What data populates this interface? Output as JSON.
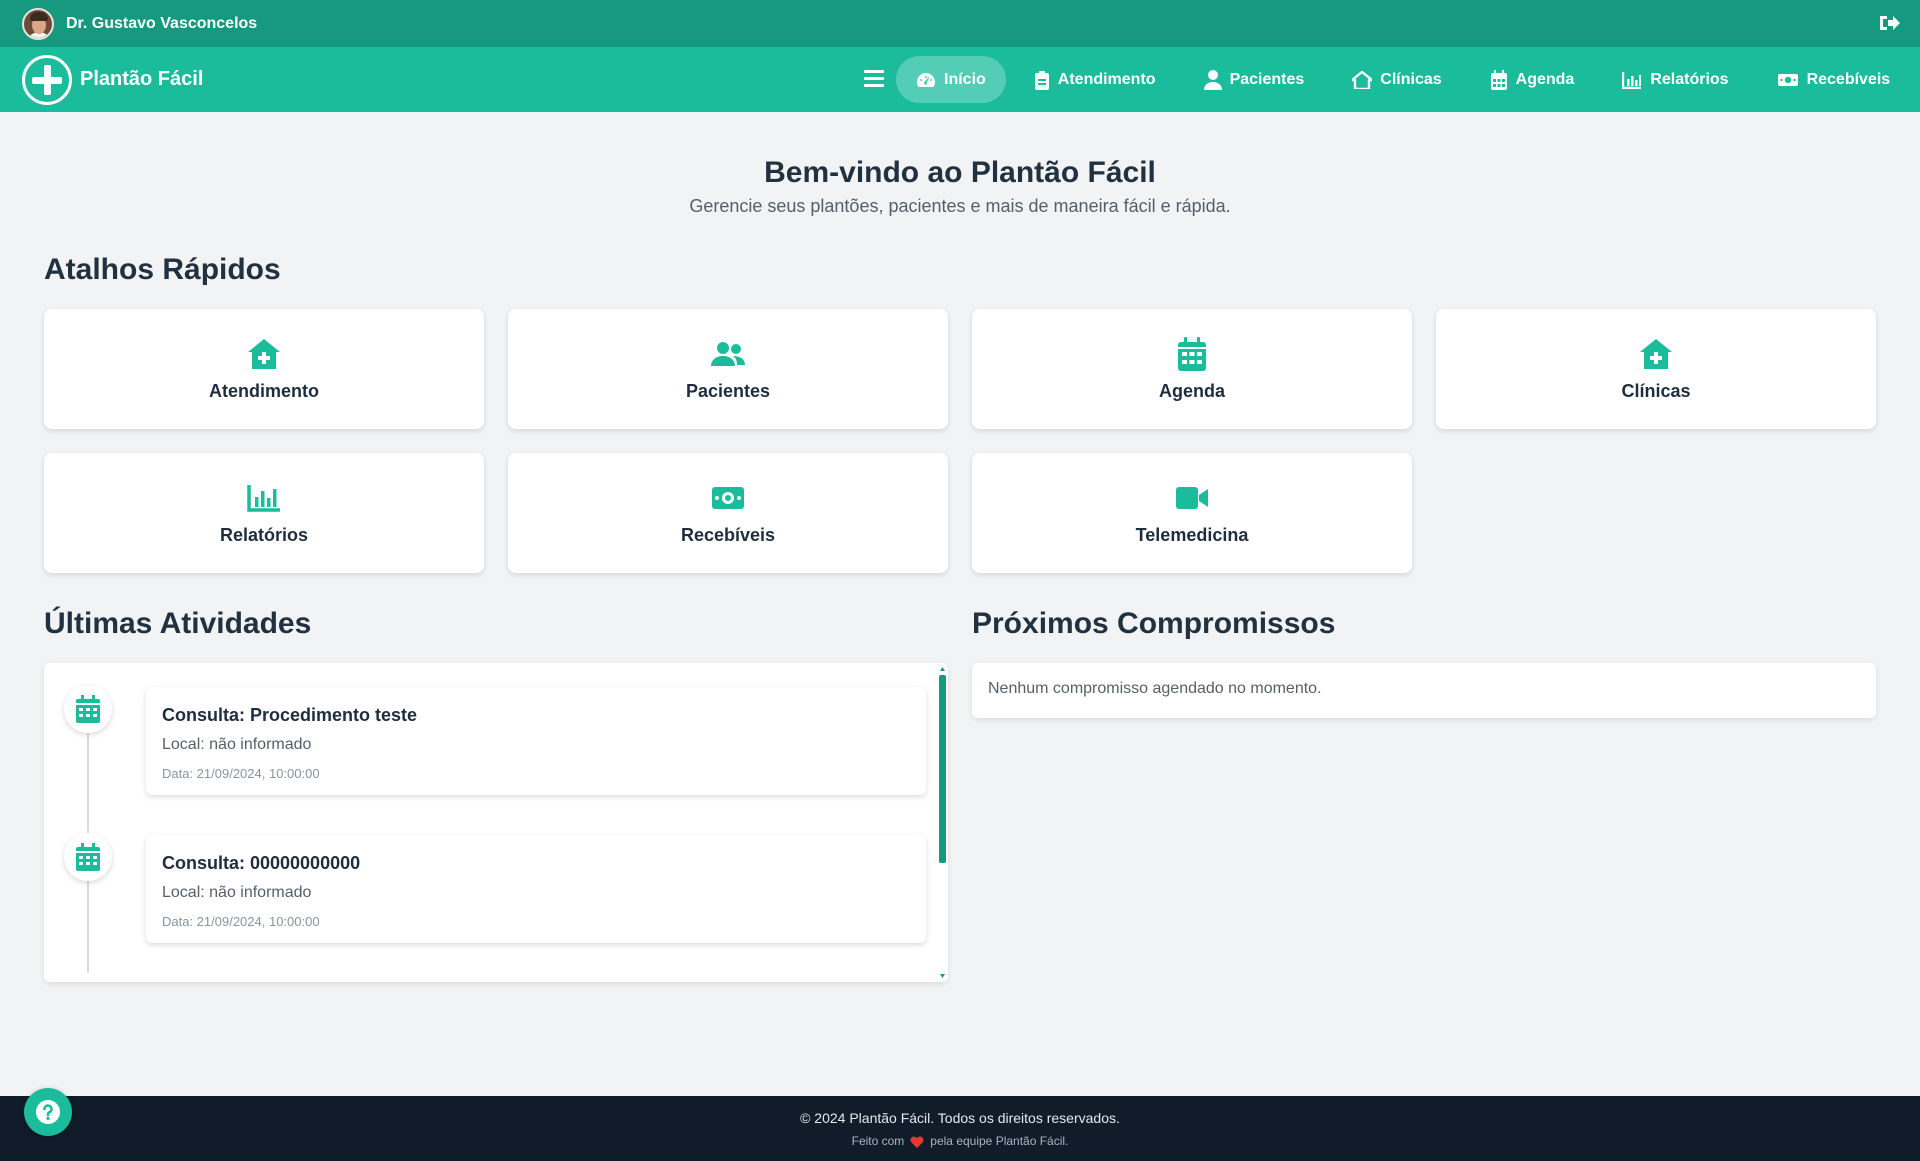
{
  "user": {
    "name": "Dr. Gustavo Vasconcelos"
  },
  "brand": {
    "name": "Plantão Fácil"
  },
  "nav": {
    "items": [
      {
        "label": "Início",
        "icon": "dashboard-icon",
        "active": true
      },
      {
        "label": "Atendimento",
        "icon": "clipboard-icon"
      },
      {
        "label": "Pacientes",
        "icon": "user-icon"
      },
      {
        "label": "Clínicas",
        "icon": "clinic-icon"
      },
      {
        "label": "Agenda",
        "icon": "calendar-icon"
      },
      {
        "label": "Relatórios",
        "icon": "bar-chart-icon"
      },
      {
        "label": "Recebíveis",
        "icon": "money-icon"
      }
    ]
  },
  "welcome": {
    "title": "Bem-vindo ao Plantão Fácil",
    "subtitle": "Gerencie seus plantões, pacientes e mais de maneira fácil e rápida."
  },
  "shortcuts": {
    "title": "Atalhos Rápidos",
    "items": [
      {
        "label": "Atendimento",
        "icon": "clinic-medical-icon"
      },
      {
        "label": "Pacientes",
        "icon": "users-icon"
      },
      {
        "label": "Agenda",
        "icon": "calendar-icon"
      },
      {
        "label": "Clínicas",
        "icon": "clinic-medical-icon"
      },
      {
        "label": "Relatórios",
        "icon": "bar-chart-icon"
      },
      {
        "label": "Recebíveis",
        "icon": "money-bill-icon"
      },
      {
        "label": "Telemedicina",
        "icon": "video-icon"
      }
    ]
  },
  "activities": {
    "title": "Últimas Atividades",
    "items": [
      {
        "title": "Consulta: Procedimento teste",
        "location": "Local: não informado",
        "date": "Data: 21/09/2024, 10:00:00"
      },
      {
        "title": "Consulta: 00000000000",
        "location": "Local: não informado",
        "date": "Data: 21/09/2024, 10:00:00"
      }
    ]
  },
  "appointments": {
    "title": "Próximos Compromissos",
    "empty_message": "Nenhum compromisso agendado no momento."
  },
  "footer": {
    "copyright": "© 2024 Plantão Fácil. Todos os direitos reservados.",
    "made_prefix": "Feito com",
    "made_suffix": "pela equipe Plantão Fácil."
  },
  "colors": {
    "topbar": "#16997e",
    "navbar": "#1abc9c",
    "accent": "#1abc9c",
    "footer": "#111c2b",
    "heart": "#e53935"
  }
}
